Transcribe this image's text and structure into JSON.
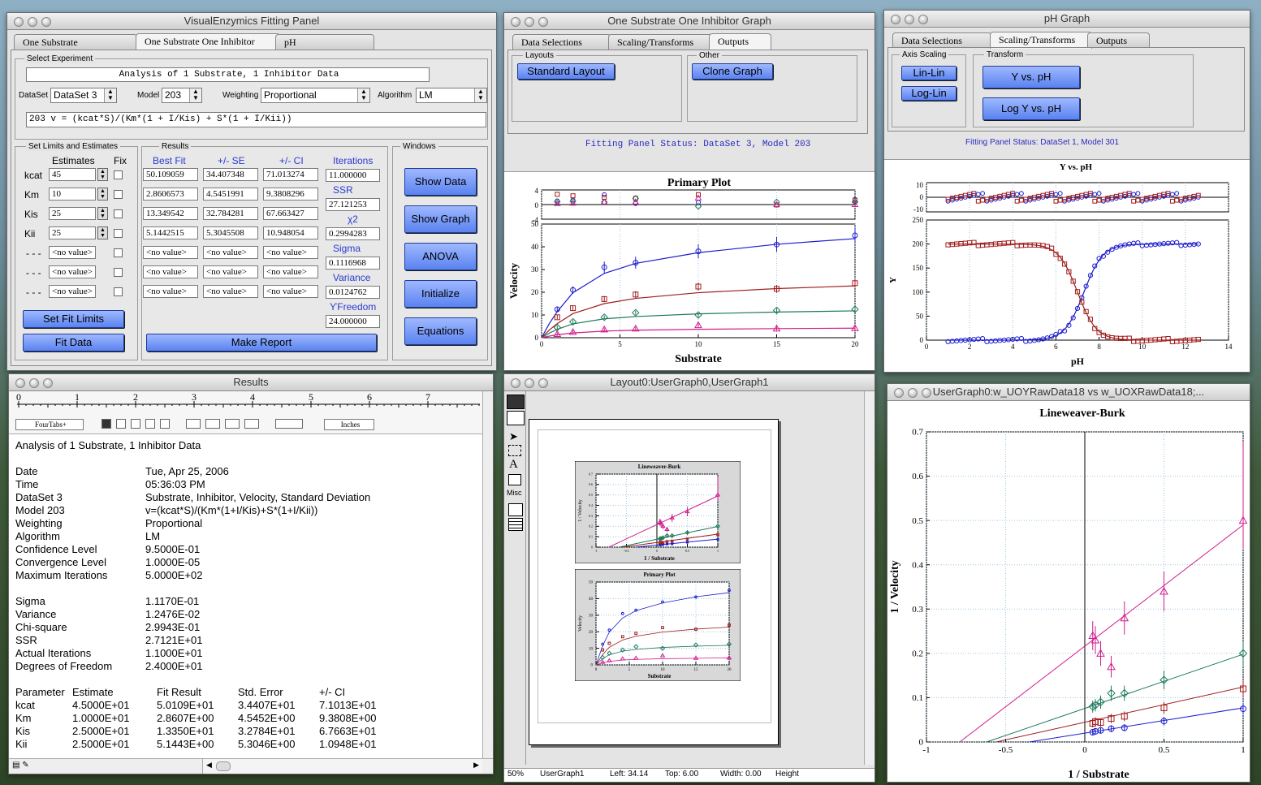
{
  "panel": {
    "title": "VisualEnzymics Fitting Panel",
    "tabs": [
      "One Substrate",
      "One Substrate One Inhibitor",
      "pH"
    ],
    "select_experiment_label": "Select Experiment",
    "experiment_title": "Analysis of 1 Substrate, 1 Inhibitor Data",
    "dataset_label": "DataSet",
    "dataset_value": "DataSet 3",
    "model_label": "Model",
    "model_value": "203",
    "weighting_label": "Weighting",
    "weighting_value": "Proportional",
    "algorithm_label": "Algorithm",
    "algorithm_value": "LM",
    "equation": "203   v =  (kcat*S)/(Km*(1 + I/Kis) + S*(1 + I/Kii))",
    "limits_label": "Set Limits and Estimates",
    "estimates_header": "Estimates",
    "fix_header": "Fix",
    "results_label": "Results",
    "windows_label": "Windows",
    "result_headers": [
      "Best Fit",
      "+/- SE",
      "+/- CI",
      "Iterations"
    ],
    "params": [
      {
        "name": "kcat",
        "estimate": "45",
        "best": "50.109059",
        "se": "34.407348",
        "ci": "71.013274"
      },
      {
        "name": "Km",
        "estimate": "10",
        "best": "2.8606573",
        "se": "4.5451991",
        "ci": "9.3808296"
      },
      {
        "name": "Kis",
        "estimate": "25",
        "best": "13.349542",
        "se": "32.784281",
        "ci": "67.663427"
      },
      {
        "name": "Kii",
        "estimate": "25",
        "best": "5.1442515",
        "se": "5.3045508",
        "ci": "10.948054"
      },
      {
        "name": "- - -",
        "estimate": "<no value>",
        "best": "<no value>",
        "se": "<no value>",
        "ci": "<no value>"
      },
      {
        "name": "- - -",
        "estimate": "<no value>",
        "best": "<no value>",
        "se": "<no value>",
        "ci": "<no value>"
      },
      {
        "name": "- - -",
        "estimate": "<no value>",
        "best": "<no value>",
        "se": "<no value>",
        "ci": "<no value>"
      }
    ],
    "stats": [
      {
        "label": "Iterations",
        "value": "11.000000"
      },
      {
        "label": "SSR",
        "value": "27.121253"
      },
      {
        "label": "χ2",
        "value": "0.2994283"
      },
      {
        "label": "Sigma",
        "value": "0.1116968"
      },
      {
        "label": "Variance",
        "value": "0.0124762"
      },
      {
        "label": "ϒFreedom",
        "value": "24.000000"
      }
    ],
    "buttons": {
      "set_fit_limits": "Set Fit Limits",
      "fit_data": "Fit Data",
      "make_report": "Make Report",
      "show_data": "Show Data",
      "show_graph": "Show Graph",
      "anova": "ANOVA",
      "initialize": "Initialize",
      "equations": "Equations"
    }
  },
  "ssoi_graph": {
    "title": "One Substrate One Inhibitor Graph",
    "tabs": [
      "Data Selections",
      "Scaling/Transforms",
      "Outputs"
    ],
    "layouts_label": "Layouts",
    "other_label": "Other",
    "standard_layout": "Standard Layout",
    "clone_graph": "Clone Graph",
    "status": "Fitting Panel Status: DataSet 3, Model 203"
  },
  "ph_graph": {
    "title": "pH Graph",
    "tabs": [
      "Data Selections",
      "Scaling/Transforms",
      "Outputs"
    ],
    "axis_scaling_label": "Axis Scaling",
    "transform_label": "Transform",
    "lin_lin": "Lin-Lin",
    "log_lin": "Log-Lin",
    "y_vs_ph": "Y vs. pH",
    "log_y_vs_ph": "Log Y vs. pH",
    "status": "Fitting Panel Status: DataSet 1, Model 301"
  },
  "results": {
    "title": "Results",
    "ruler_marks": [
      "0",
      "1",
      "2",
      "3",
      "4",
      "5",
      "6",
      "7"
    ],
    "ruler_ruler": "FourTabs+",
    "units": "Inches",
    "lines": [
      [
        "Analysis of 1 Substrate, 1 Inhibitor Data",
        ""
      ],
      [
        "",
        ""
      ],
      [
        "Date",
        "Tue, Apr 25, 2006"
      ],
      [
        "Time",
        "05:36:03 PM"
      ],
      [
        "DataSet 3",
        "Substrate, Inhibitor, Velocity, Standard Deviation"
      ],
      [
        "Model 203",
        "v=(kcat*S)/(Km*(1+I/Kis)+S*(1+I/Kii))"
      ],
      [
        "Weighting",
        "Proportional"
      ],
      [
        "Algorithm",
        "LM"
      ],
      [
        "Confidence Level",
        "  9.5000E-01"
      ],
      [
        "Convergence Level",
        "  1.0000E-05"
      ],
      [
        "Maximum Iterations",
        "  5.0000E+02"
      ],
      [
        "",
        ""
      ],
      [
        "Sigma",
        "  1.1170E-01"
      ],
      [
        "Variance",
        "  1.2476E-02"
      ],
      [
        "Chi-square",
        "  2.9943E-01"
      ],
      [
        "SSR",
        "  2.7121E+01"
      ],
      [
        "Actual Iterations",
        "  1.1000E+01"
      ],
      [
        "Degrees of Freedom",
        "  2.4000E+01"
      ]
    ],
    "param_header": [
      "Parameter",
      "Estimate",
      "Fit Result",
      "Std. Error",
      "+/- CI"
    ],
    "param_rows": [
      [
        "kcat",
        "4.5000E+01",
        "5.0109E+01",
        "3.4407E+01",
        "7.1013E+01"
      ],
      [
        "Km",
        "1.0000E+01",
        "2.8607E+00",
        "4.5452E+00",
        "9.3808E+00"
      ],
      [
        "Kis",
        "2.5000E+01",
        "1.3350E+01",
        "3.2784E+01",
        "6.7663E+01"
      ],
      [
        "Kii",
        "2.5000E+01",
        "5.1443E+00",
        "5.3046E+00",
        "1.0948E+01"
      ]
    ]
  },
  "layout": {
    "title": "Layout0:UserGraph0,UserGraph1",
    "tools_misc": "Misc",
    "status_bar": {
      "zoom": "50%",
      "object": "UserGraph1",
      "left": "Left: 34.14",
      "top": "Top: 6.00",
      "width": "Width: 0.00",
      "height": "Height"
    },
    "thumb1_title": "Lineweaver-Burk",
    "thumb1_xlabel": "1 / Substrate",
    "thumb1_ylabel": "1 / Velocity",
    "thumb2_title": "Primary Plot",
    "thumb2_xlabel": "Substrate",
    "thumb2_ylabel": "Velocity"
  },
  "lb_window": {
    "title": "UserGraph0:w_UOYRawData18 vs w_UOXRawData18;..."
  },
  "chart_data": [
    {
      "type": "scatter",
      "title": "Primary Plot",
      "xlabel": "Substrate",
      "ylabel": "Velocity",
      "xlim": [
        0,
        20
      ],
      "ylim": [
        0,
        50
      ],
      "xticks": [
        0,
        5,
        10,
        15,
        20
      ],
      "yticks": [
        0,
        10,
        20,
        30,
        40,
        50
      ],
      "residual_yticks": [
        -4,
        0,
        4
      ],
      "x": [
        1,
        2,
        4,
        6,
        10,
        15,
        20
      ],
      "series": [
        {
          "color": "#1c1ccf",
          "marker": "circle",
          "values": [
            12.5,
            21,
            31,
            33,
            38,
            41,
            45
          ],
          "fit": [
            11.5,
            19.8,
            28.3,
            32.7,
            37.4,
            41.1,
            43.6
          ]
        },
        {
          "color": "#a01c1c",
          "marker": "square",
          "values": [
            9,
            13,
            17,
            19,
            22.5,
            21.5,
            24
          ],
          "fit": [
            6.2,
            10.6,
            15.0,
            17.3,
            19.8,
            21.6,
            22.8
          ]
        },
        {
          "color": "#1c7a5a",
          "marker": "diamond",
          "values": [
            4.5,
            7,
            9,
            11,
            10,
            12,
            12.5
          ],
          "fit": [
            3.7,
            6.1,
            8.3,
            9.3,
            10.5,
            11.3,
            11.8
          ]
        },
        {
          "color": "#d21c8c",
          "marker": "triangle",
          "values": [
            1.6,
            2.5,
            3.6,
            4,
            5.5,
            4,
            4.2
          ],
          "fit": [
            1.3,
            2.1,
            2.9,
            3.3,
            3.7,
            4.0,
            4.2
          ]
        }
      ]
    },
    {
      "type": "scatter",
      "title": "Y vs. pH",
      "xlabel": "pH",
      "ylabel": "Y",
      "xlim": [
        0,
        14
      ],
      "ylim": [
        0,
        250
      ],
      "xticks": [
        0,
        2,
        4,
        6,
        8,
        10,
        12,
        14
      ],
      "yticks": [
        0,
        50,
        100,
        150,
        200,
        250
      ],
      "residual_yticks": [
        -10,
        0,
        10
      ],
      "series": [
        {
          "color": "#1c1ccf",
          "marker": "circle",
          "pKa": 7.3,
          "direction": "rising",
          "max": 200
        },
        {
          "color": "#a01c1c",
          "marker": "square",
          "pKa": 7.0,
          "direction": "falling",
          "max": 200
        }
      ]
    },
    {
      "type": "scatter",
      "title": "Lineweaver-Burk",
      "xlabel": "1 / Substrate",
      "ylabel": "1 / Velocity",
      "xlim": [
        -1.0,
        1.0
      ],
      "ylim": [
        0,
        0.7
      ],
      "xticks": [
        -1.0,
        -0.5,
        0.0,
        0.5,
        1.0
      ],
      "yticks": [
        0.0,
        0.1,
        0.2,
        0.3,
        0.4,
        0.5,
        0.6,
        0.7
      ],
      "x": [
        0.05,
        0.0667,
        0.1,
        0.1667,
        0.25,
        0.5,
        1.0
      ],
      "series": [
        {
          "color": "#1c1ccf",
          "marker": "circle",
          "values": [
            0.022,
            0.024,
            0.026,
            0.03,
            0.032,
            0.047,
            0.075
          ],
          "line": [
            [
              -0.35,
              0
            ],
            [
              1.0,
              0.077
            ]
          ]
        },
        {
          "color": "#a01c1c",
          "marker": "square",
          "values": [
            0.042,
            0.046,
            0.044,
            0.053,
            0.058,
            0.077,
            0.12
          ],
          "line": [
            [
              -0.56,
              0
            ],
            [
              1.0,
              0.124
            ]
          ]
        },
        {
          "color": "#1c7a5a",
          "marker": "diamond",
          "values": [
            0.08,
            0.083,
            0.09,
            0.11,
            0.11,
            0.14,
            0.2
          ],
          "line": [
            [
              -0.62,
              0
            ],
            [
              1.0,
              0.198
            ]
          ]
        },
        {
          "color": "#d21c8c",
          "marker": "triangle",
          "values": [
            0.24,
            0.23,
            0.2,
            0.17,
            0.28,
            0.34,
            0.5
          ],
          "line": [
            [
              -0.79,
              0
            ],
            [
              1.0,
              0.49
            ]
          ]
        }
      ]
    }
  ]
}
